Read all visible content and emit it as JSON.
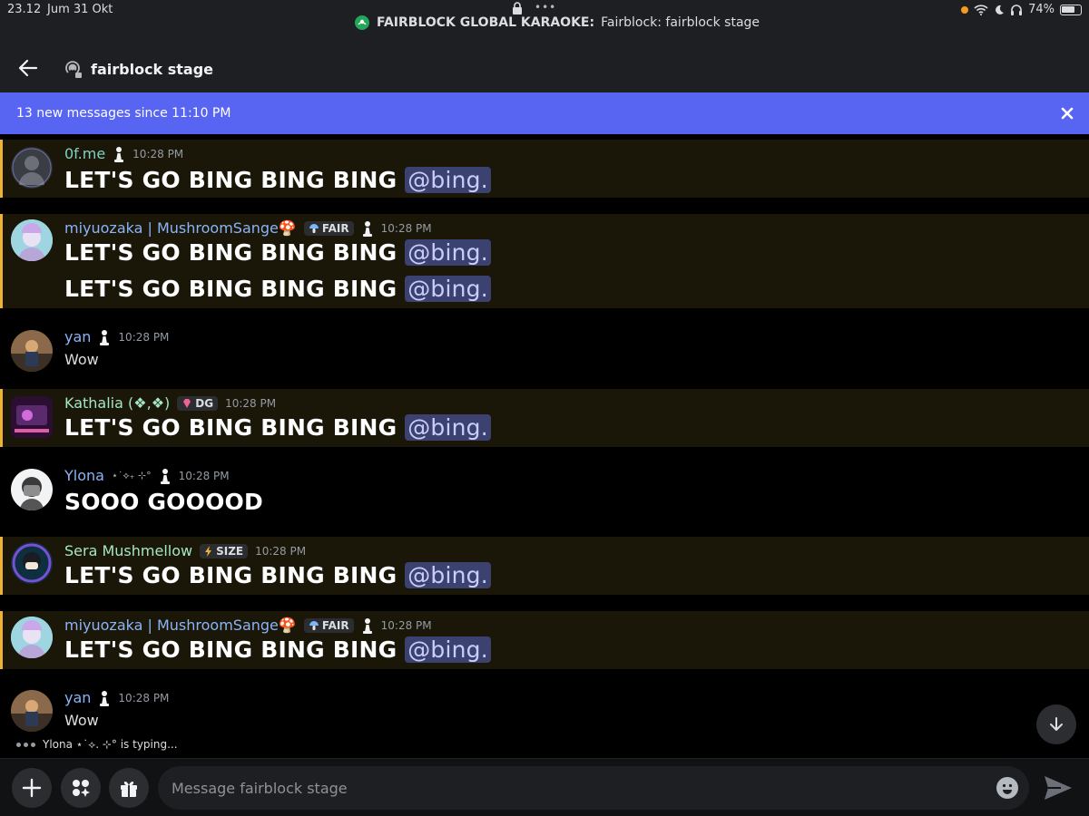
{
  "status_bar": {
    "time": "23.12",
    "date": "Jum 31 Okt",
    "dots": "•••",
    "stage_title": "FAIRBLOCK GLOBAL KARAOKE:",
    "stage_sub": "Fairblock: fairblock stage",
    "battery": "74%"
  },
  "header": {
    "title": "fairblock stage"
  },
  "banner": {
    "text": "13 new messages since 11:10 PM"
  },
  "messages": [
    {
      "user": "0f.me",
      "time": "10:28 PM",
      "lines": [
        "LET'S GO BING BING BING"
      ],
      "mention": "@bing."
    },
    {
      "user": "miyuozaka | MushroomSange🍄",
      "tag": "FAIR",
      "time": "10:28 PM",
      "lines": [
        "LET'S GO BING BING BING",
        "LET'S GO BING BING BING"
      ],
      "mention": "@bing."
    },
    {
      "user": "yan",
      "time": "10:28 PM",
      "text": "Wow"
    },
    {
      "user": "Kathalia (❖,❖)",
      "tag": "DG",
      "time": "10:28 PM",
      "lines": [
        "LET'S GO BING BING BING"
      ],
      "mention": "@bing."
    },
    {
      "user": "Ylona",
      "sparkles": "⋆˙⟡₊ ⊹°",
      "time": "10:28 PM",
      "lines": [
        "SOOO GOOOOD"
      ]
    },
    {
      "user": "Sera Mushmellow",
      "tag": "SIZE",
      "time": "10:28 PM",
      "lines": [
        "LET'S GO BING BING BING"
      ],
      "mention": "@bing."
    },
    {
      "user": "miyuozaka | MushroomSange🍄",
      "tag": "FAIR",
      "time": "10:28 PM",
      "lines": [
        "LET'S GO BING BING BING"
      ],
      "mention": "@bing."
    },
    {
      "user": "yan",
      "time": "10:28 PM",
      "text": "Wow"
    }
  ],
  "typing": {
    "text": "Ylona ⋆˙⟡. ⊹° is typing..."
  },
  "composer": {
    "placeholder": "Message fairblock stage"
  },
  "colors": {
    "accent": "#5865f2",
    "highlight": "#f0b232",
    "mention_bg": "#3c4270"
  }
}
